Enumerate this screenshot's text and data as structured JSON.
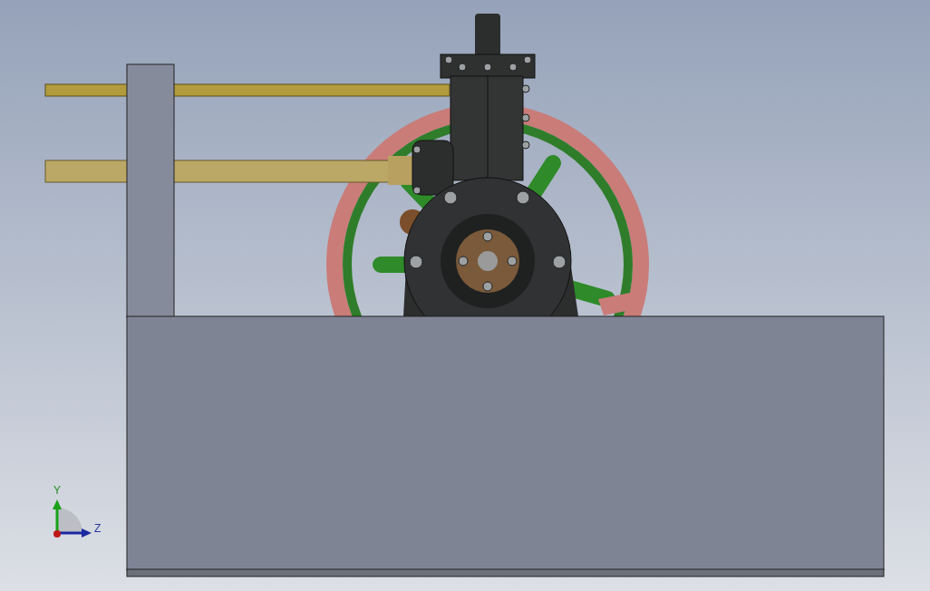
{
  "view_triad": {
    "axes": [
      {
        "kind": "y",
        "label": "Y"
      },
      {
        "kind": "z",
        "label": "Z"
      }
    ]
  }
}
